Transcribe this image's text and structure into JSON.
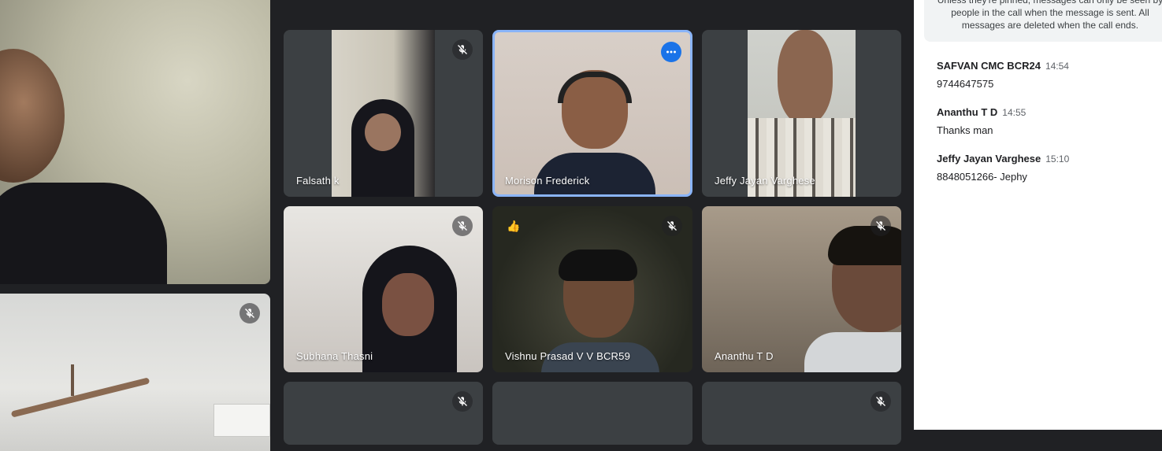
{
  "participants": [
    {
      "name": "Falsath k",
      "muted": true
    },
    {
      "name": "Morison Frederick",
      "muted": false,
      "speaking": true
    },
    {
      "name": "Jeffy Jayan Varghese",
      "muted": false
    },
    {
      "name": "Subhana Thasni",
      "muted": true
    },
    {
      "name": "Vishnu Prasad V V BCR59",
      "muted": true,
      "reaction": "👍"
    },
    {
      "name": "Ananthu T D",
      "muted": true
    }
  ],
  "chat": {
    "notice_lines": [
      "Unless they're pinned, messages can only be seen by",
      "people in the call when the message is sent. All",
      "messages are deleted when the call ends."
    ],
    "messages": [
      {
        "sender": "SAFVAN CMC BCR24",
        "time": "14:54",
        "text": "9744647575"
      },
      {
        "sender": "Ananthu T D",
        "time": "14:55",
        "text": "Thanks man"
      },
      {
        "sender": "Jeffy Jayan Varghese",
        "time": "15:10",
        "text": "8848051266- Jephy"
      }
    ]
  },
  "colors": {
    "background": "#202124",
    "tile": "#3c4043",
    "active_border": "#8ab4f8",
    "more_button": "#1a73e8"
  }
}
